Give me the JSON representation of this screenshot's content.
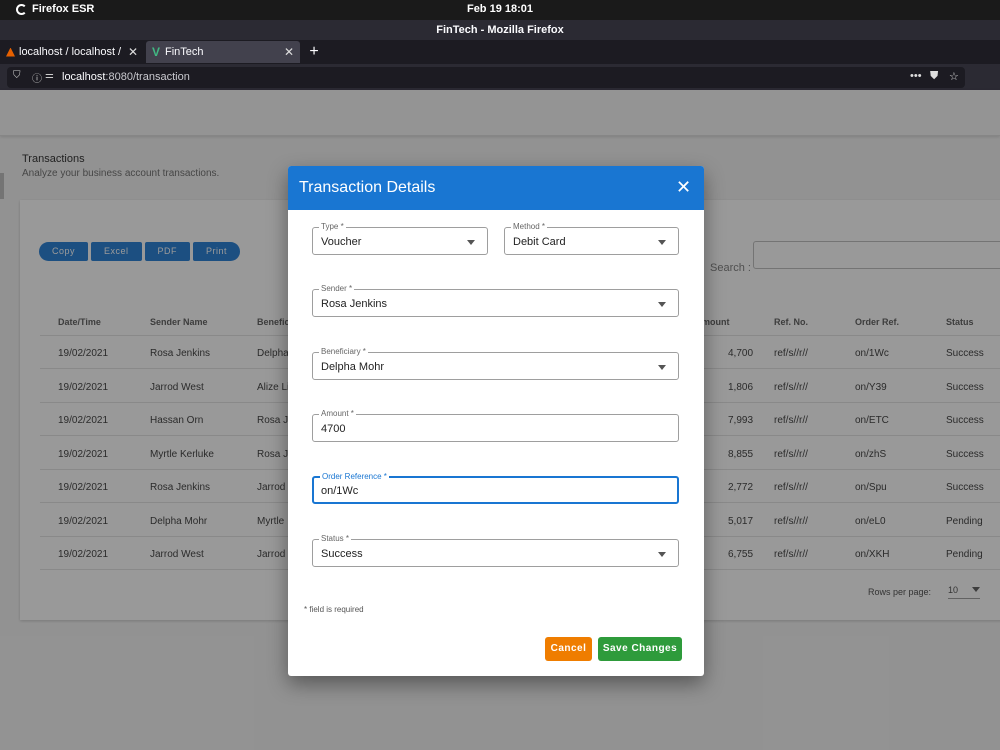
{
  "os_bar": {
    "app_name": "Firefox ESR",
    "clock": "Feb 19  18:01"
  },
  "browser": {
    "window_title": "FinTech - Mozilla Firefox",
    "tabs": [
      {
        "label": "localhost / localhost / fint"
      },
      {
        "label": "FinTech"
      }
    ],
    "url_host": "localhost",
    "url_rest": ":8080/transaction"
  },
  "page": {
    "title": "Transactions",
    "subtitle": "Analyze your business account transactions.",
    "export_buttons": [
      "Copy",
      "Excel",
      "PDF",
      "Print"
    ],
    "search_label": "Search :",
    "table": {
      "headers": [
        "Date/Time",
        "Sender Name",
        "Benefici",
        "mount",
        "Ref. No.",
        "Order Ref.",
        "Status"
      ],
      "rows": [
        [
          "19/02/2021",
          "Rosa Jenkins",
          "Delpha",
          "4,700",
          "ref/s//r//",
          "on/1Wc",
          "Success"
        ],
        [
          "19/02/2021",
          "Jarrod West",
          "Alize Li",
          "1,806",
          "ref/s//r//",
          "on/Y39",
          "Success"
        ],
        [
          "19/02/2021",
          "Hassan Orn",
          "Rosa J",
          "7,993",
          "ref/s//r//",
          "on/ETC",
          "Success"
        ],
        [
          "19/02/2021",
          "Myrtle Kerluke",
          "Rosa J",
          "8,855",
          "ref/s//r//",
          "on/zhS",
          "Success"
        ],
        [
          "19/02/2021",
          "Rosa Jenkins",
          "Jarrod",
          "2,772",
          "ref/s//r//",
          "on/Spu",
          "Success"
        ],
        [
          "19/02/2021",
          "Delpha Mohr",
          "Myrtle",
          "5,017",
          "ref/s//r//",
          "on/eL0",
          "Pending"
        ],
        [
          "19/02/2021",
          "Jarrod West",
          "Jarrod",
          "6,755",
          "ref/s//r//",
          "on/XKH",
          "Pending"
        ]
      ]
    },
    "rows_per_page_label": "Rows per page:",
    "rows_per_page_value": "10"
  },
  "dialog": {
    "title": "Transaction Details",
    "fields": {
      "type": {
        "label": "Type *",
        "value": "Voucher"
      },
      "method": {
        "label": "Method *",
        "value": "Debit Card"
      },
      "sender": {
        "label": "Sender *",
        "value": "Rosa Jenkins"
      },
      "beneficiary": {
        "label": "Beneficiary *",
        "value": "Delpha Mohr"
      },
      "amount": {
        "label": "Amount *",
        "value": "4700"
      },
      "order_ref": {
        "label": "Order Reference *",
        "value": "on/1Wc"
      },
      "status": {
        "label": "Status *",
        "value": "Success"
      }
    },
    "required_note": "* field is required",
    "cancel_label": "Cancel",
    "save_label": "Save Changes"
  },
  "colors": {
    "primary": "#1976d2",
    "cancel": "#ef7d00",
    "save": "#2e9b3b"
  }
}
